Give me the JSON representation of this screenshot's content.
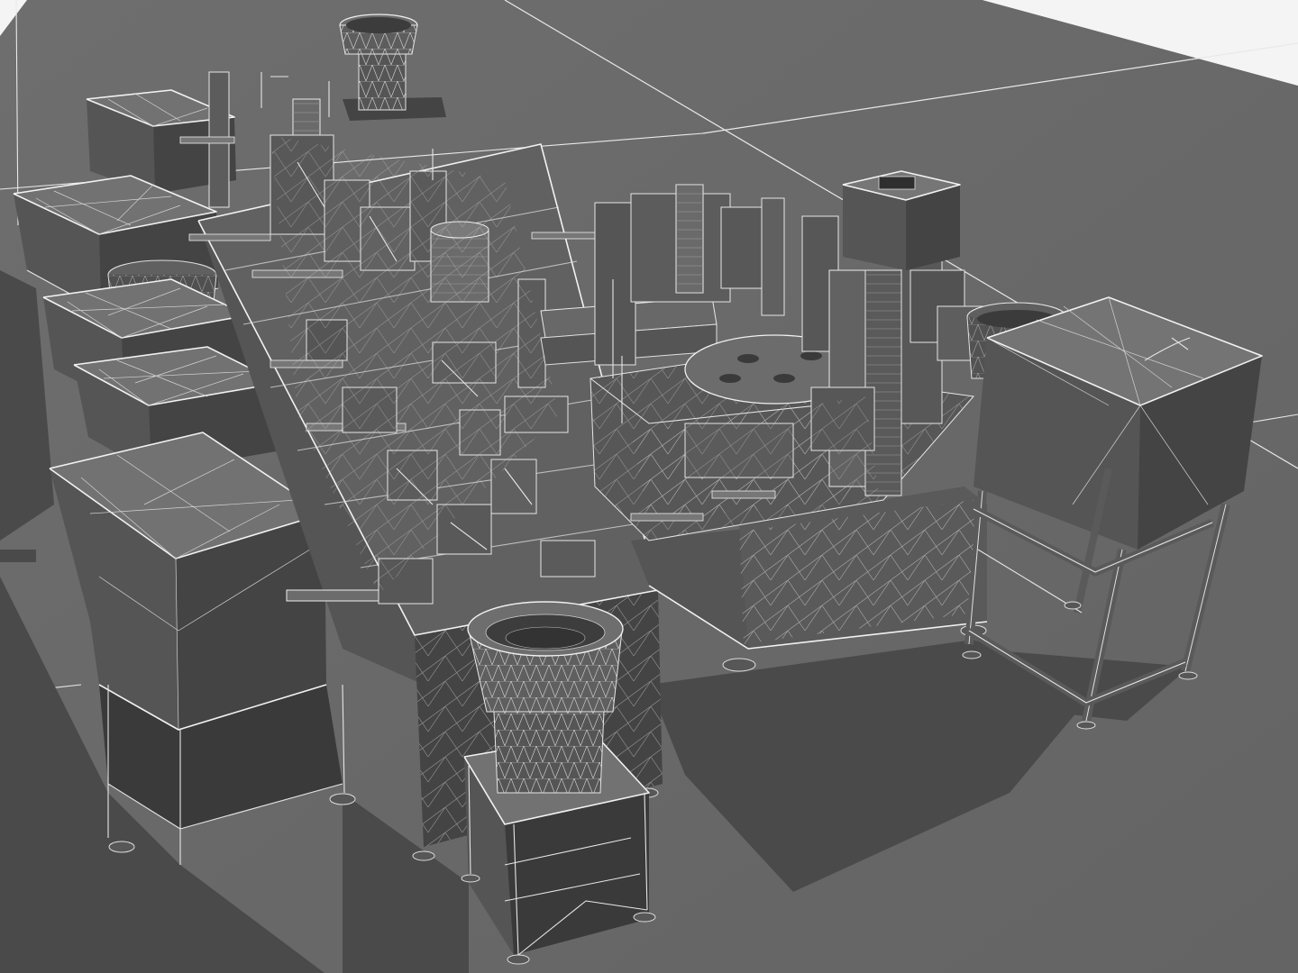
{
  "scene": {
    "subject": "",
    "render_style": "clay-wireframe",
    "colors": {
      "background": "#f4f4f4",
      "floor": "#6b6b6b",
      "shadow": "#4a4a4a",
      "model": "#5a5a5a",
      "wireframe": "#e6e6e6"
    }
  }
}
